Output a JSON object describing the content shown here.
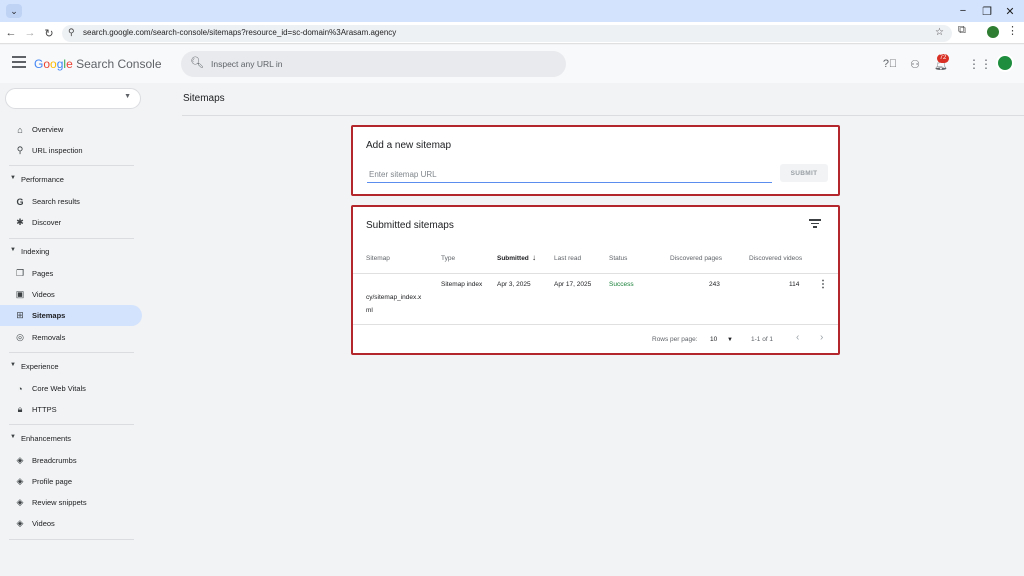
{
  "browser": {
    "url": "search.google.com/search-console/sitemaps?resource_id=sc-domain%3Arasam.agency",
    "icons": [
      "tab-search-icon",
      "minimize-icon",
      "restore-icon",
      "close-icon",
      "back-icon",
      "forward-icon",
      "reload-icon",
      "site-info-icon",
      "bookmark-star-icon",
      "extensions-icon",
      "profile-icon",
      "chrome-menu-icon"
    ]
  },
  "header": {
    "logo_google": [
      "G",
      "o",
      "o",
      "g",
      "l",
      "e"
    ],
    "logo_product": "Search Console",
    "search_placeholder": "Inspect any URL in",
    "notification_count": "72",
    "icons": [
      "menu-icon",
      "search-icon",
      "help-icon",
      "users-settings-icon",
      "bell-icon",
      "apps-grid-icon"
    ]
  },
  "sidebar": {
    "property_value": "",
    "items": [
      {
        "label": "Overview",
        "icon": "home-icon"
      },
      {
        "label": "URL inspection",
        "icon": "search-icon"
      },
      {
        "section": "Performance"
      },
      {
        "label": "Search results",
        "icon": "google-g-icon"
      },
      {
        "label": "Discover",
        "icon": "asterisk-icon"
      },
      {
        "section": "Indexing"
      },
      {
        "label": "Pages",
        "icon": "pages-icon"
      },
      {
        "label": "Videos",
        "icon": "video-icon"
      },
      {
        "label": "Sitemaps",
        "icon": "sitemap-icon",
        "active": true
      },
      {
        "label": "Removals",
        "icon": "eye-off-icon"
      },
      {
        "section": "Experience"
      },
      {
        "label": "Core Web Vitals",
        "icon": "speed-icon"
      },
      {
        "label": "HTTPS",
        "icon": "lock-icon"
      },
      {
        "section": "Enhancements"
      },
      {
        "label": "Breadcrumbs",
        "icon": "layers-icon"
      },
      {
        "label": "Profile page",
        "icon": "layers-icon"
      },
      {
        "label": "Review snippets",
        "icon": "layers-icon"
      },
      {
        "label": "Videos",
        "icon": "layers-icon"
      }
    ]
  },
  "main": {
    "page_title": "Sitemaps",
    "add_card": {
      "title": "Add a new sitemap",
      "input_placeholder": "Enter sitemap URL",
      "input_value": "",
      "submit_label": "SUBMIT"
    },
    "submitted_card": {
      "title": "Submitted sitemaps",
      "columns": [
        "Sitemap",
        "Type",
        "Submitted",
        "Last read",
        "Status",
        "Discovered pages",
        "Discovered videos"
      ],
      "sort_indicator": "↓",
      "rows": [
        {
          "sitemap_line1": "cy/sitemap_index.x",
          "sitemap_line2": "ml",
          "type": "Sitemap index",
          "submitted": "Apr 3, 2025",
          "last_read": "Apr 17, 2025",
          "status": "Success",
          "discovered_pages": "243",
          "discovered_videos": "114"
        }
      ],
      "pagination": {
        "rows_per_page_label": "Rows per page:",
        "rows_per_page_value": "10",
        "range": "1-1 of 1"
      }
    }
  },
  "colors": {
    "accent": "#1a73e8",
    "active_nav": "#d3e3fd",
    "highlight_border": "#b3262b",
    "success": "#188038"
  }
}
